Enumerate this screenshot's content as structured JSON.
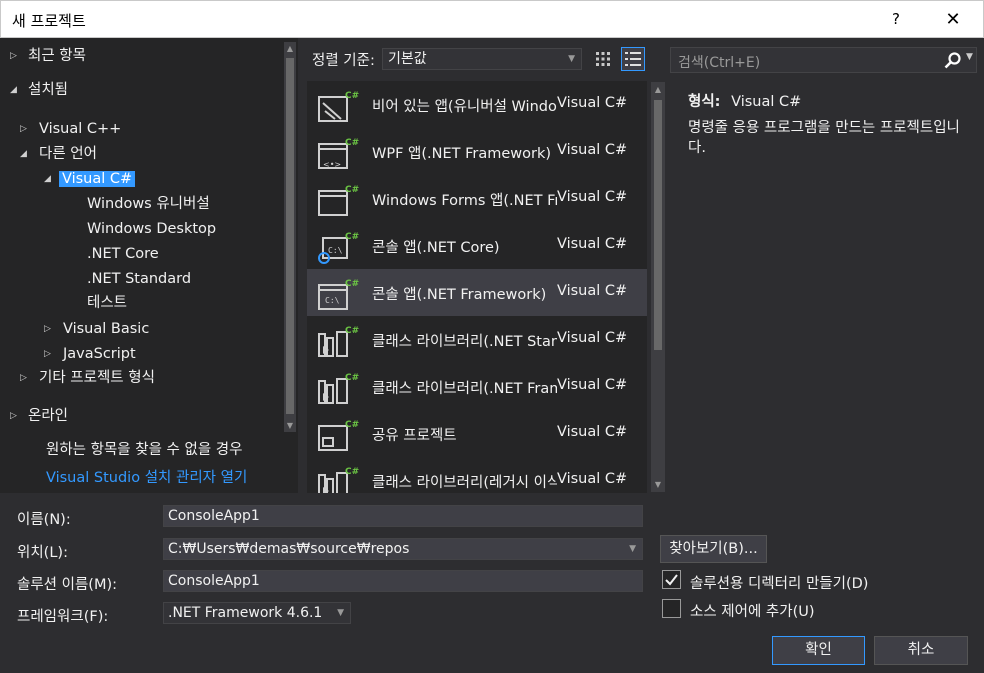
{
  "window": {
    "title": "새 프로젝트",
    "help": "?",
    "close": "✕"
  },
  "tree": {
    "recent": "최근 항목",
    "installed": "설치됨",
    "visual_cpp": "Visual C++",
    "other_langs": "다른 언어",
    "visual_csharp": "Visual C#",
    "windows_universal": "Windows 유니버설",
    "windows_desktop": "Windows Desktop",
    "net_core": ".NET Core",
    "net_standard": ".NET Standard",
    "test": "테스트",
    "visual_basic": "Visual Basic",
    "javascript": "JavaScript",
    "other_types": "기타 프로젝트 형식",
    "online": "온라인",
    "not_found": "원하는 항목을 찾을 수 없을 경우",
    "installer_link": "Visual Studio 설치 관리자 열기"
  },
  "sort": {
    "label": "정렬 기준:",
    "value": "기본값"
  },
  "templates": [
    {
      "name": "비어 있는 앱(유니버설 Windows)",
      "lang": "Visual C#",
      "icon": "blank-app-icon"
    },
    {
      "name": "WPF 앱(.NET Framework)",
      "lang": "Visual C#",
      "icon": "wpf-app-icon"
    },
    {
      "name": "Windows Forms 앱(.NET Framework)",
      "lang": "Visual C#",
      "icon": "winforms-app-icon"
    },
    {
      "name": "콘솔 앱(.NET Core)",
      "lang": "Visual C#",
      "icon": "console-core-icon"
    },
    {
      "name": "콘솔 앱(.NET Framework)",
      "lang": "Visual C#",
      "icon": "console-framework-icon"
    },
    {
      "name": "클래스 라이브러리(.NET Standard)",
      "lang": "Visual C#",
      "icon": "class-library-icon"
    },
    {
      "name": "클래스 라이브러리(.NET Framework)",
      "lang": "Visual C#",
      "icon": "class-library-icon"
    },
    {
      "name": "공유 프로젝트",
      "lang": "Visual C#",
      "icon": "shared-project-icon"
    },
    {
      "name": "클래스 라이브러리(레거시 이식 가능)",
      "lang": "Visual C#",
      "icon": "class-library-icon"
    }
  ],
  "selected_template_index": 4,
  "search": {
    "placeholder": "검색(Ctrl+E)"
  },
  "description": {
    "type_key": "형식:",
    "type_value": "Visual C#",
    "text": "명령줄 응용 프로그램을 만드는 프로젝트입니다."
  },
  "form": {
    "name_label": "이름(N):",
    "name_value": "ConsoleApp1",
    "location_label": "위치(L):",
    "location_value": "C:₩Users₩demas₩source₩repos",
    "solution_label": "솔루션 이름(M):",
    "solution_value": "ConsoleApp1",
    "framework_label": "프레임워크(F):",
    "framework_value": ".NET Framework 4.6.1",
    "browse_label": "찾아보기(B)...",
    "create_dir_label": "솔루션용 디렉터리 만들기(D)",
    "create_dir_checked": true,
    "source_control_label": "소스 제어에 추가(U)",
    "source_control_checked": false,
    "ok_label": "확인",
    "cancel_label": "취소"
  },
  "colors": {
    "accent": "#3399ff",
    "bg": "#2d2d30",
    "pane": "#252526"
  }
}
